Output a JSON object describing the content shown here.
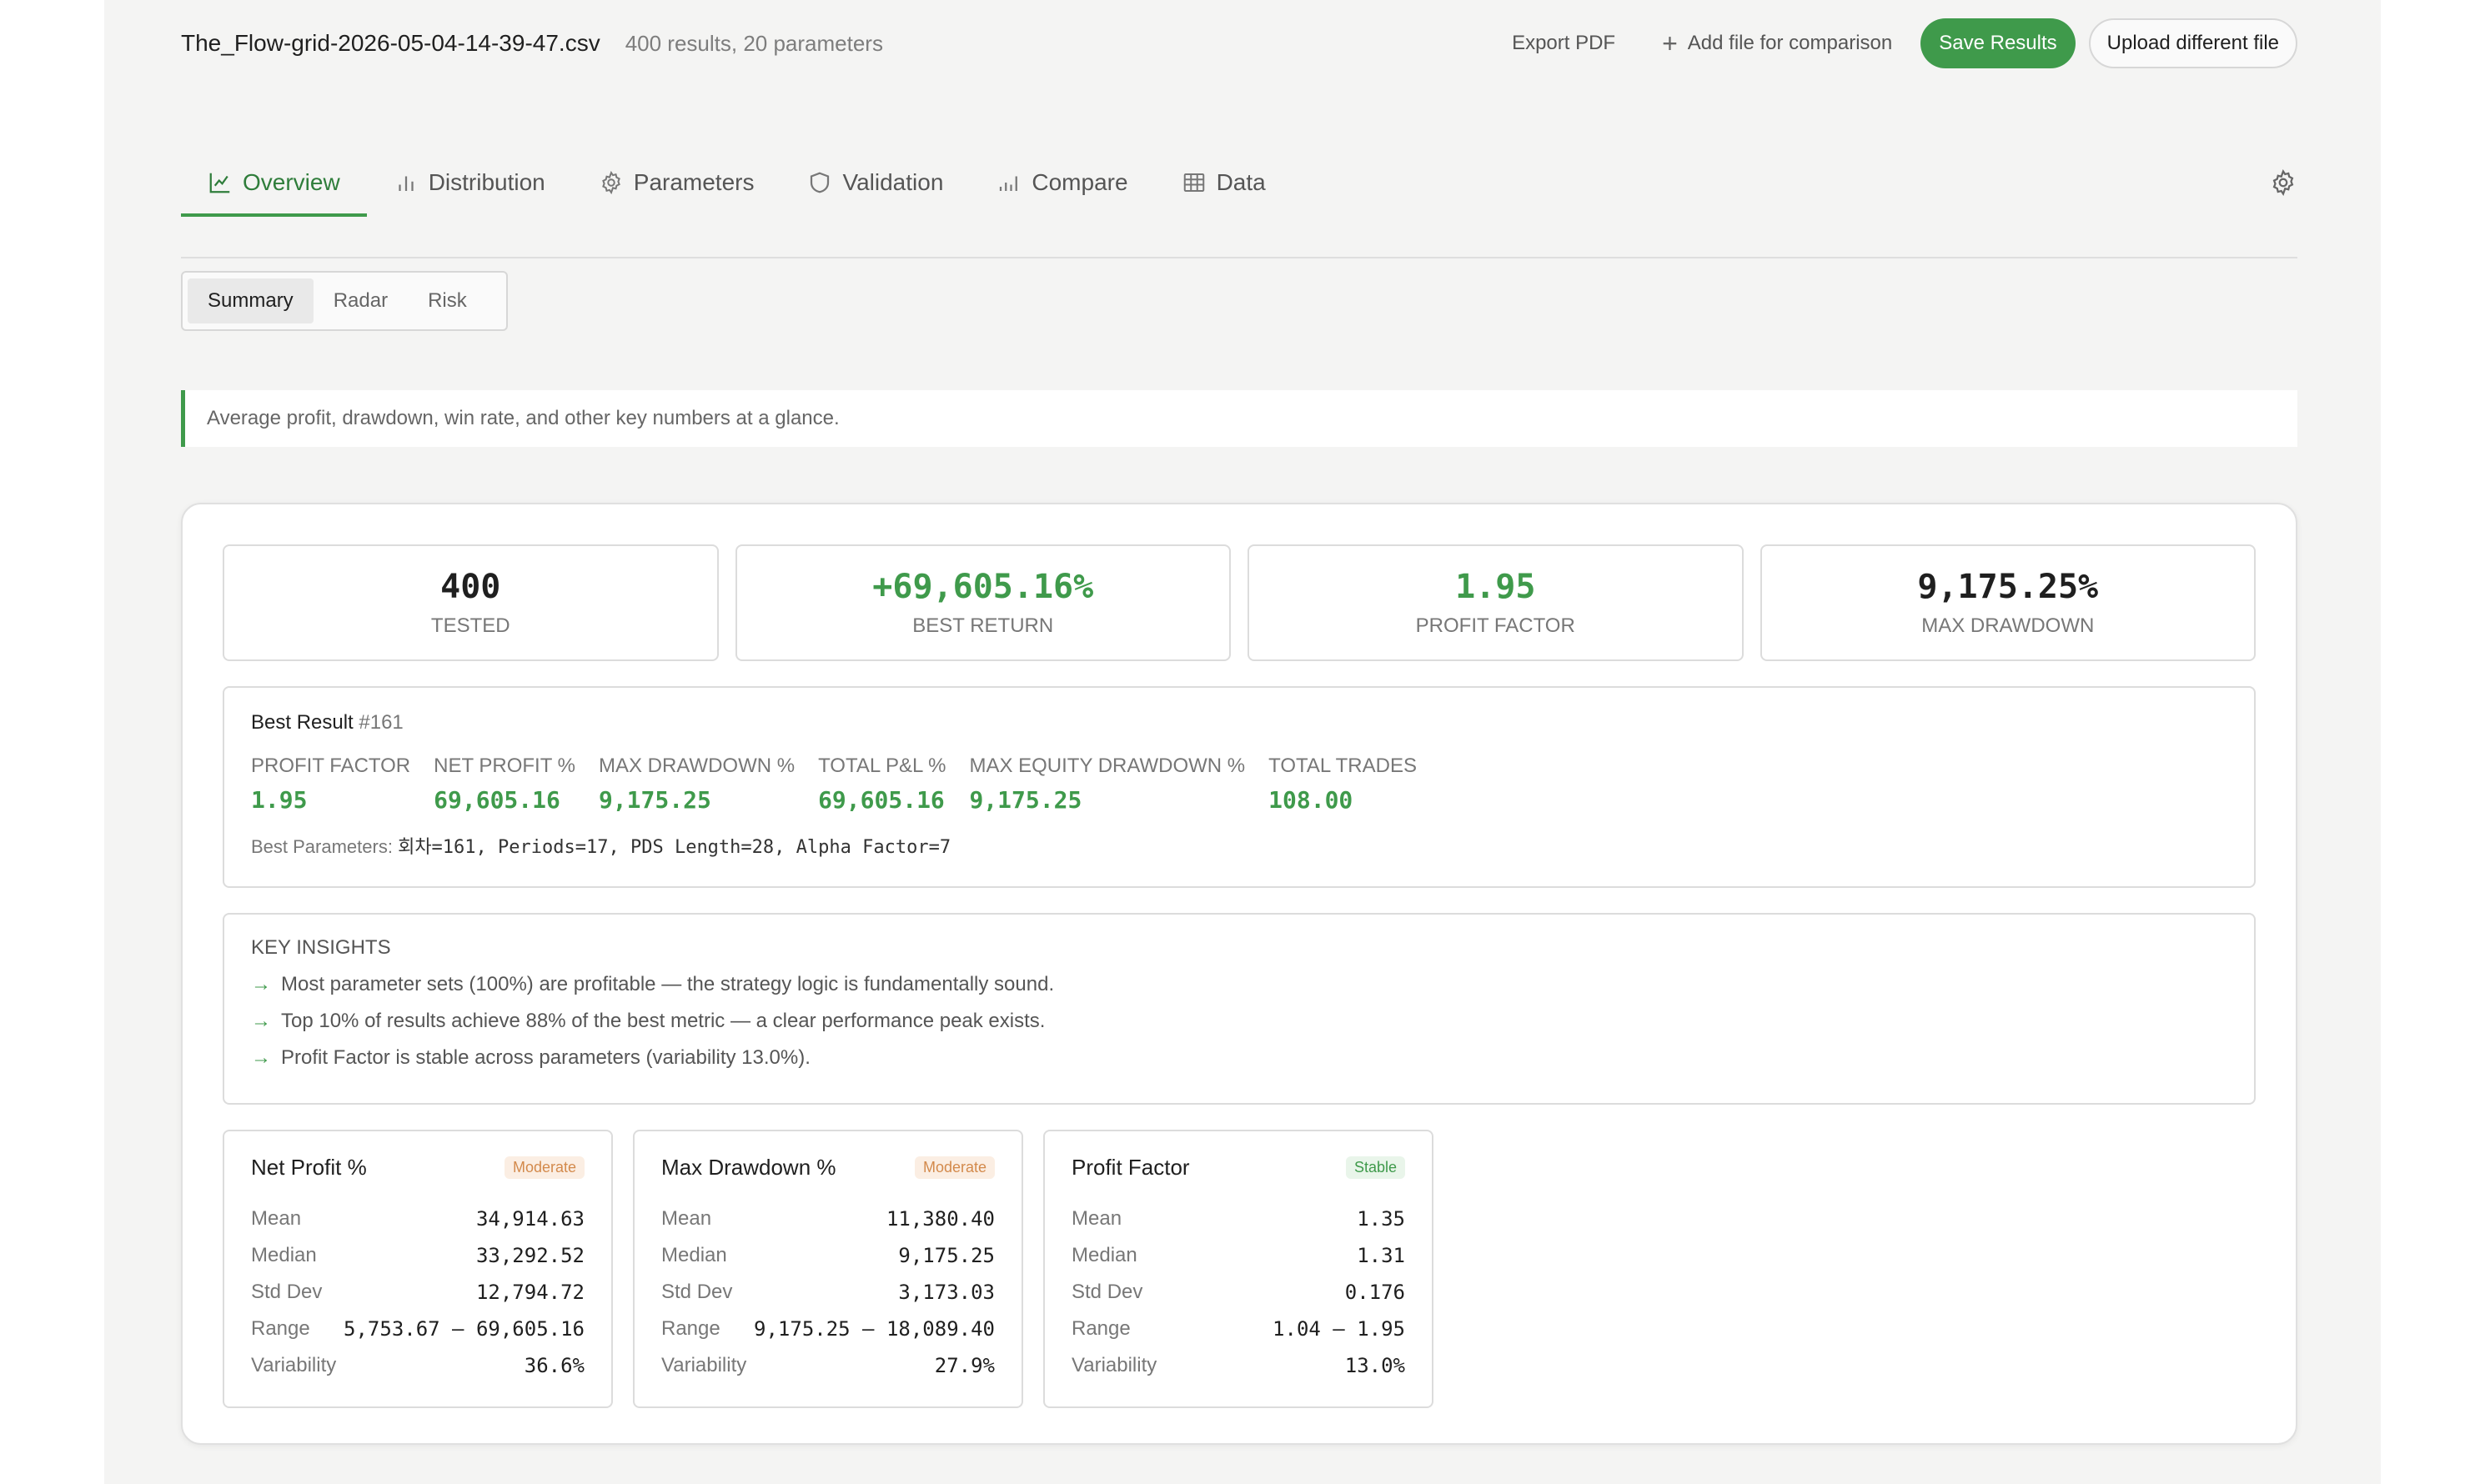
{
  "header": {
    "file_name": "The_Flow-grid-2026-05-04-14-39-47.csv",
    "file_meta": "400 results, 20 parameters",
    "export_label": "Export PDF",
    "add_file_label": "Add file for comparison",
    "save_label": "Save Results",
    "upload_label": "Upload different file"
  },
  "tabs": [
    {
      "label": "Overview",
      "icon": "line-chart-icon",
      "active": true
    },
    {
      "label": "Distribution",
      "icon": "bar-chart-icon",
      "active": false
    },
    {
      "label": "Parameters",
      "icon": "gear-icon",
      "active": false
    },
    {
      "label": "Validation",
      "icon": "shield-icon",
      "active": false
    },
    {
      "label": "Compare",
      "icon": "compare-bars-icon",
      "active": false
    },
    {
      "label": "Data",
      "icon": "table-icon",
      "active": false
    }
  ],
  "subtabs": [
    {
      "label": "Summary",
      "active": true
    },
    {
      "label": "Radar",
      "active": false
    },
    {
      "label": "Risk",
      "active": false
    }
  ],
  "hint": "Average profit, drawdown, win rate, and other key numbers at a glance.",
  "stats": [
    {
      "value": "400",
      "label": "TESTED",
      "color": "#1f1f1f"
    },
    {
      "value": "+69,605.16%",
      "label": "BEST RETURN",
      "color": "#3f9a4b"
    },
    {
      "value": "1.95",
      "label": "PROFIT FACTOR",
      "color": "#3f9a4b"
    },
    {
      "value": "9,175.25%",
      "label": "MAX DRAWDOWN",
      "color": "#1f1f1f"
    }
  ],
  "best_result": {
    "title": "Best Result",
    "number": "#161",
    "metrics": [
      {
        "label": "PROFIT FACTOR",
        "value": "1.95"
      },
      {
        "label": "NET PROFIT %",
        "value": "69,605.16"
      },
      {
        "label": "MAX DRAWDOWN %",
        "value": "9,175.25"
      },
      {
        "label": "TOTAL P&L %",
        "value": "69,605.16"
      },
      {
        "label": "MAX EQUITY DRAWDOWN %",
        "value": "9,175.25"
      },
      {
        "label": "TOTAL TRADES",
        "value": "108.00"
      }
    ],
    "params_label": "Best Parameters:",
    "params_value": "회차=161, Periods=17, PDS Length=28, Alpha Factor=7"
  },
  "insights": {
    "title": "KEY INSIGHTS",
    "items": [
      "Most parameter sets (100%) are profitable — the strategy logic is fundamentally sound.",
      "Top 10% of results achieve 88% of the best metric — a clear performance peak exists.",
      "Profit Factor is stable across parameters (variability 13.0%)."
    ]
  },
  "distributions": [
    {
      "title": "Net Profit %",
      "badge": "Moderate",
      "badge_type": "moderate",
      "rows": [
        {
          "label": "Mean",
          "value": "34,914.63"
        },
        {
          "label": "Median",
          "value": "33,292.52"
        },
        {
          "label": "Std Dev",
          "value": "12,794.72"
        },
        {
          "label": "Range",
          "value": "5,753.67 — 69,605.16"
        },
        {
          "label": "Variability",
          "value": "36.6%"
        }
      ]
    },
    {
      "title": "Max Drawdown %",
      "badge": "Moderate",
      "badge_type": "moderate",
      "rows": [
        {
          "label": "Mean",
          "value": "11,380.40"
        },
        {
          "label": "Median",
          "value": "9,175.25"
        },
        {
          "label": "Std Dev",
          "value": "3,173.03"
        },
        {
          "label": "Range",
          "value": "9,175.25 — 18,089.40"
        },
        {
          "label": "Variability",
          "value": "27.9%"
        }
      ]
    },
    {
      "title": "Profit Factor",
      "badge": "Stable",
      "badge_type": "stable",
      "rows": [
        {
          "label": "Mean",
          "value": "1.35"
        },
        {
          "label": "Median",
          "value": "1.31"
        },
        {
          "label": "Std Dev",
          "value": "0.176"
        },
        {
          "label": "Range",
          "value": "1.04 — 1.95"
        },
        {
          "label": "Variability",
          "value": "13.0%"
        }
      ]
    }
  ]
}
